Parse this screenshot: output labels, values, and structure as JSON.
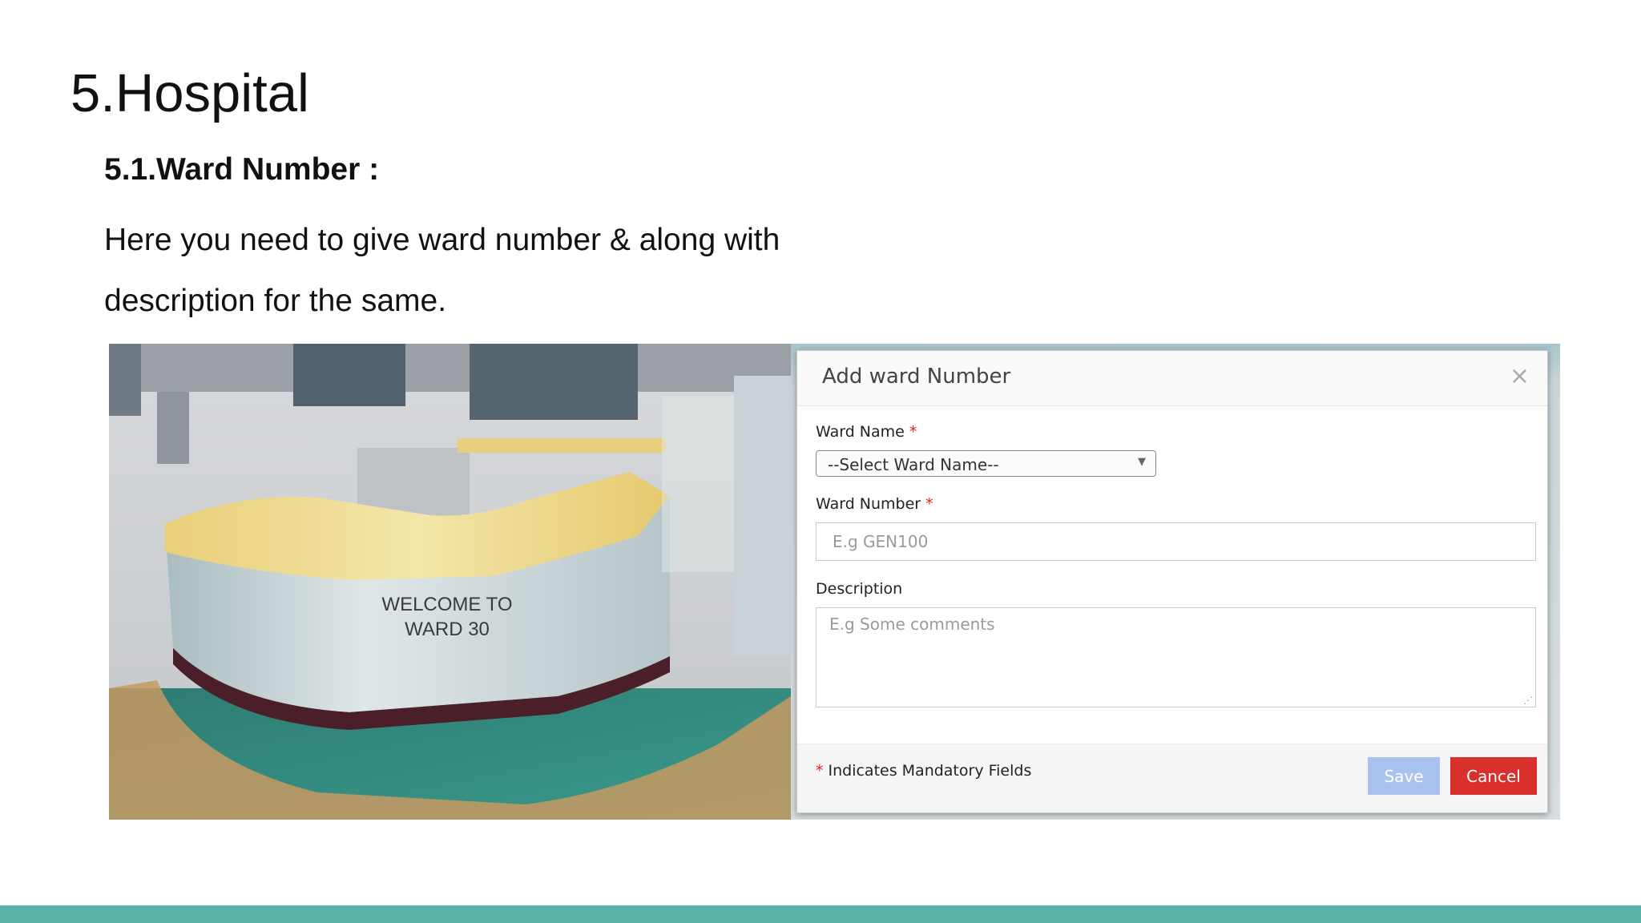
{
  "slide": {
    "title": "5.Hospital",
    "subheading": "5.1.Ward Number :",
    "paragraph": "Here you need to give ward number & along with description for the same."
  },
  "photo": {
    "sign_text": "WELCOME TO\nWARD 30"
  },
  "dialog": {
    "title": "Add ward Number",
    "close_symbol": "×",
    "ward_name_label": "Ward Name",
    "ward_name_select_value": "--Select Ward Name--",
    "ward_number_label": "Ward Number",
    "ward_number_placeholder": "E.g GEN100",
    "description_label": "Description",
    "description_placeholder": "E.g Some comments",
    "required_marker": "*",
    "mandatory_note": "Indicates Mandatory Fields",
    "save_label": "Save",
    "cancel_label": "Cancel"
  },
  "colors": {
    "accent_bar": "#5bb3a9",
    "required": "#e02020",
    "save_button": "#a9c2ef",
    "cancel_button": "#d9302c"
  }
}
